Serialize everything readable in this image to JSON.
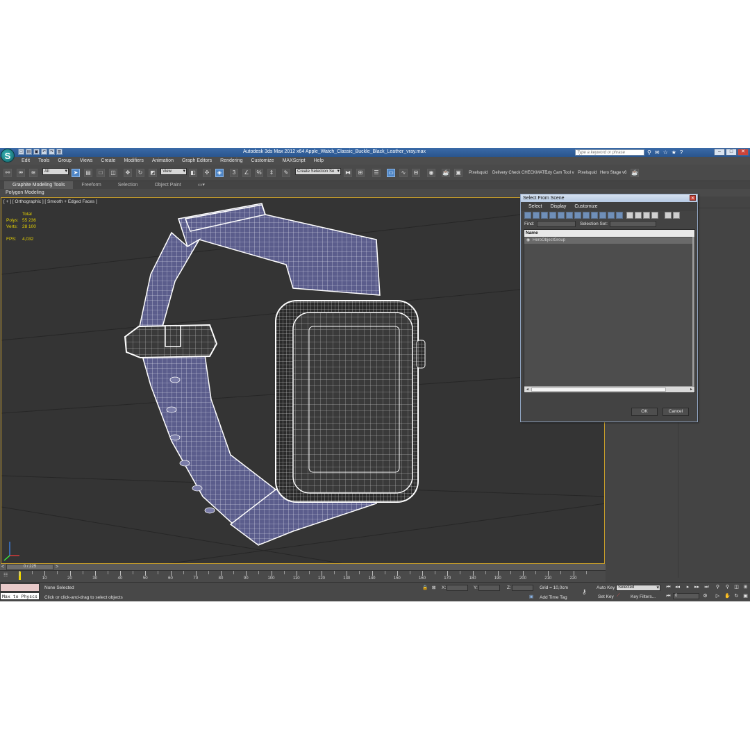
{
  "titlebar": {
    "title": "Autodesk 3ds Max  2012 x64     Apple_Watch_Classic_Buckle_Black_Leather_vray.max",
    "search_placeholder": "Type a keyword or phrase"
  },
  "menu": [
    "Edit",
    "Tools",
    "Group",
    "Views",
    "Create",
    "Modifiers",
    "Animation",
    "Graph Editors",
    "Rendering",
    "Customize",
    "MAXScript",
    "Help"
  ],
  "toolbar": {
    "filter_dropdown": "All",
    "ref_coord_dropdown": "View",
    "selection_set_dropdown": "Create Selection Se",
    "plugin_labels": [
      "Pixelsquid",
      "Delivery Check",
      "CHECKMATE",
      "uty Cam Tool v",
      "Pixelsquid",
      "Hero Stage v6"
    ]
  },
  "ribbon": {
    "tabs": [
      "Graphite Modeling Tools",
      "Freeform",
      "Selection",
      "Object Paint"
    ],
    "sub_label": "Polygon Modeling"
  },
  "viewport": {
    "label": "[ + ] [ Orthographic ] [ Smooth + Edged Faces ]",
    "stats": {
      "header": "Total",
      "polys_label": "Polys:",
      "polys_value": "55 236",
      "verts_label": "Verts:",
      "verts_value": "28 100",
      "fps_label": "FPS:",
      "fps_value": "4,032"
    }
  },
  "dialog": {
    "title": "Select From Scene",
    "menu": [
      "Select",
      "Display",
      "Customize"
    ],
    "find_label": "Find:",
    "selection_set_label": "Selection Set:",
    "column_name": "Name",
    "rows": [
      "HeroObjectGroup"
    ],
    "ok_label": "OK",
    "cancel_label": "Cancel"
  },
  "timeline": {
    "frame_range": "0 / 225",
    "ticks": [
      "10",
      "20",
      "30",
      "40",
      "50",
      "60",
      "70",
      "80",
      "90",
      "100",
      "110",
      "120",
      "130",
      "140",
      "150",
      "160",
      "170",
      "180",
      "190",
      "200",
      "210",
      "220"
    ]
  },
  "status": {
    "maxscript_text": "Max to Physcs",
    "selection_status": "None Selected",
    "prompt": "Click or click-and-drag to select objects",
    "x_label": "X:",
    "y_label": "Y:",
    "z_label": "Z:",
    "grid": "Grid = 10,0cm",
    "add_time_tag": "Add Time Tag",
    "auto_key": "Auto Key",
    "set_key": "Set Key",
    "key_dropdown": "Selected",
    "key_filters": "Key Filters...",
    "current_frame": "0"
  },
  "colors": {
    "accent": "#4f86c6",
    "viewport_border": "#c59c2a",
    "stats_text": "#e6d200",
    "mesh_band": "#5b5d8c",
    "mesh_wire": "#ffffff"
  }
}
